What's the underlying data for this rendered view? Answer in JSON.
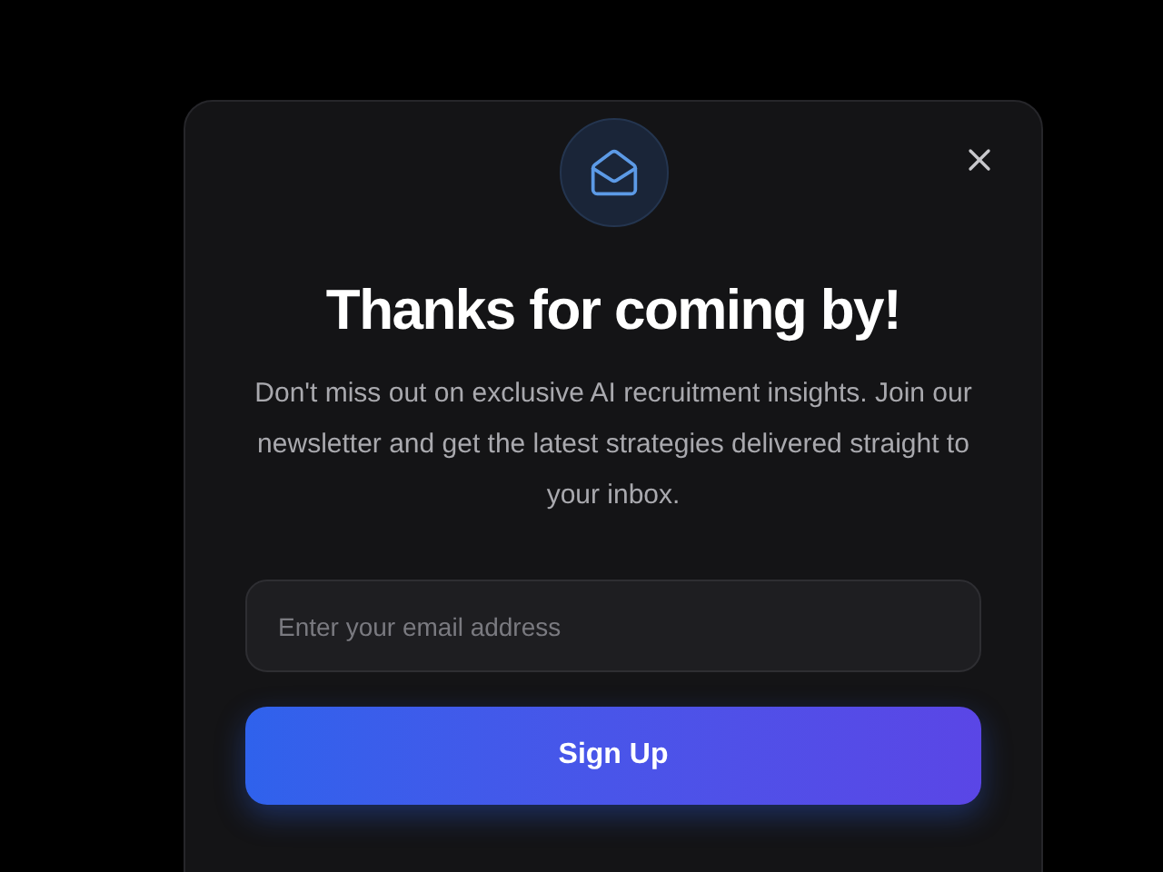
{
  "dialog": {
    "title": "Thanks for coming by!",
    "message": "Don't miss out on exclusive AI recruitment insights. Join our newsletter and get the latest strategies delivered straight to your inbox.",
    "email_field": {
      "placeholder": "Enter your email address"
    },
    "submit_button": "Sign Up"
  }
}
